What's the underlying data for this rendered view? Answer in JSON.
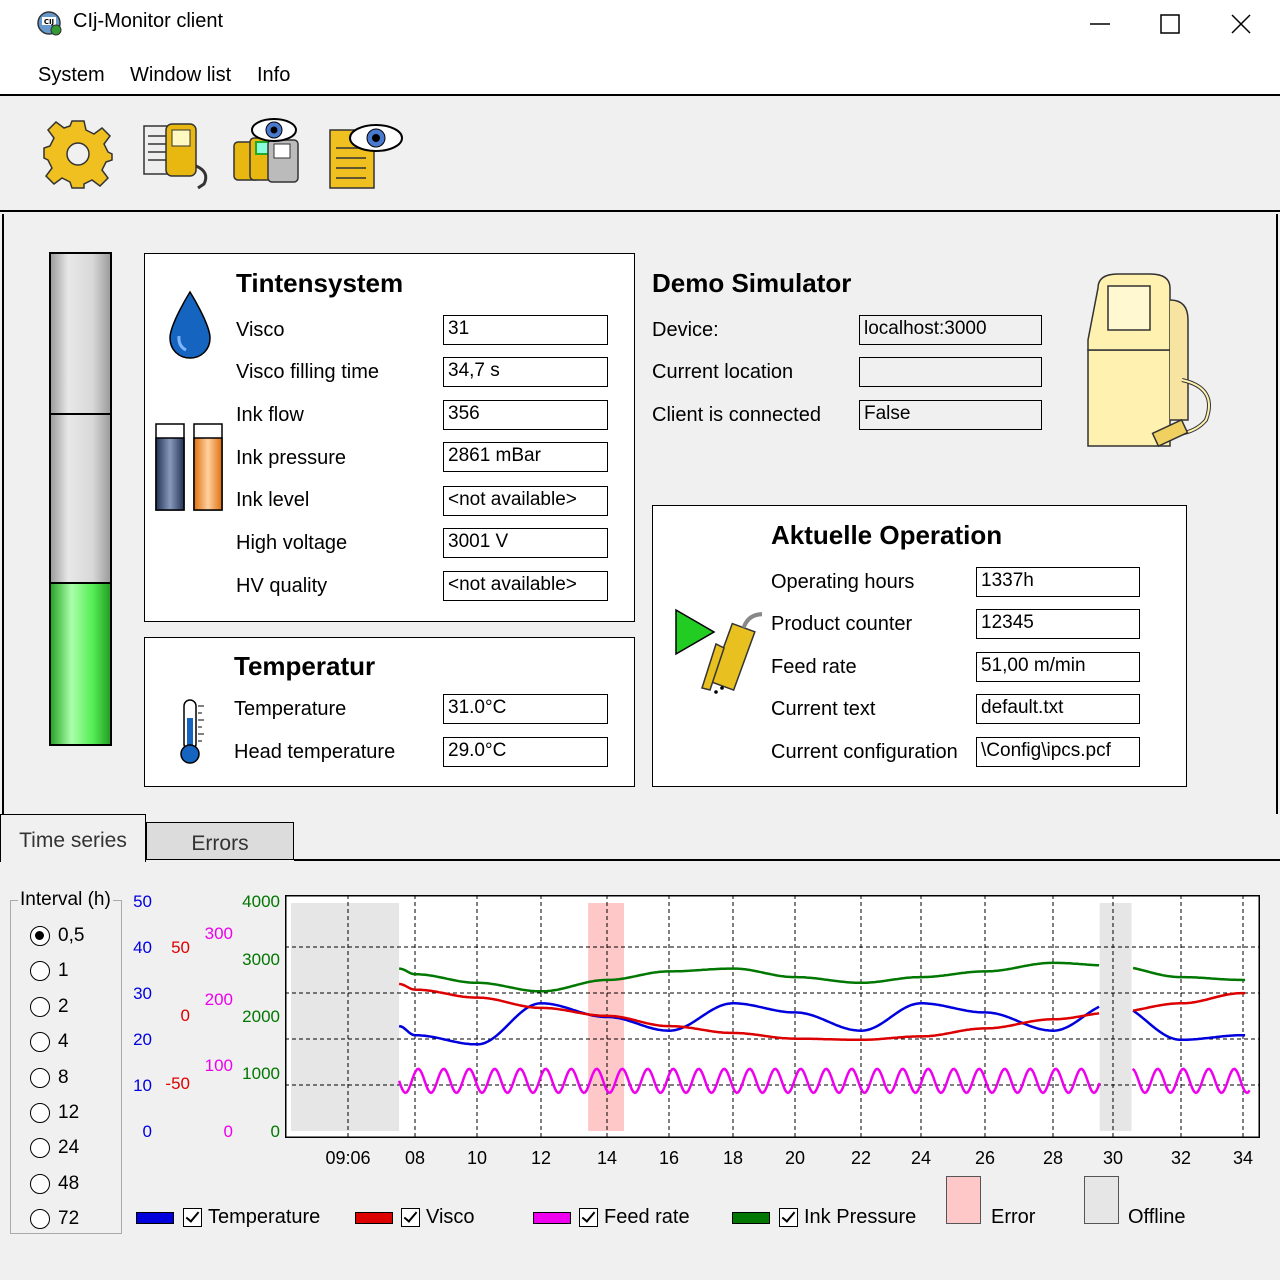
{
  "window": {
    "title": "CIj-Monitor client",
    "app_icon": "cij-logo-icon"
  },
  "menu": {
    "items": [
      "System",
      "Window list",
      "Info"
    ]
  },
  "toolbar": {
    "buttons": [
      "gear-icon",
      "printer-document-icon",
      "printers-watch-icon",
      "document-watch-icon"
    ]
  },
  "ink_system": {
    "title": "Tintensystem",
    "fields": [
      {
        "label": "Visco",
        "value": "31"
      },
      {
        "label": "Visco filling time",
        "value": "34,7 s"
      },
      {
        "label": "Ink flow",
        "value": "356"
      },
      {
        "label": "Ink pressure",
        "value": "2861 mBar"
      },
      {
        "label": "Ink level",
        "value": "<not available>"
      },
      {
        "label": "High voltage",
        "value": "3001 V"
      },
      {
        "label": "HV quality",
        "value": "<not available>"
      }
    ]
  },
  "temperature_panel": {
    "title": "Temperatur",
    "fields": [
      {
        "label": "Temperature",
        "value": "31.0°C"
      },
      {
        "label": "Head temperature",
        "value": "29.0°C"
      }
    ]
  },
  "device": {
    "title": "Demo Simulator",
    "fields": [
      {
        "label": "Device:",
        "value": "localhost:3000"
      },
      {
        "label": "Current location",
        "value": ""
      },
      {
        "label": "Client is connected",
        "value": "False"
      }
    ]
  },
  "operation": {
    "title": "Aktuelle Operation",
    "fields": [
      {
        "label": "Operating hours",
        "value": "1337h"
      },
      {
        "label": "Product counter",
        "value": "12345"
      },
      {
        "label": "Feed rate",
        "value": "51,00 m/min"
      },
      {
        "label": "Current text",
        "value": "default.txt"
      },
      {
        "label": "Current configuration",
        "value": "\\Config\\ipcs.pcf"
      }
    ]
  },
  "level_gauge": {
    "fill_fraction": 0.33,
    "color": "#33e033"
  },
  "tabs": [
    "Time series",
    "Errors"
  ],
  "interval": {
    "title": "Interval (h)",
    "options": [
      "0,5",
      "1",
      "2",
      "4",
      "8",
      "12",
      "24",
      "48",
      "72"
    ],
    "selected": "0,5"
  },
  "chart_data": {
    "type": "line",
    "x_ticks": [
      "09:06",
      "08",
      "10",
      "12",
      "14",
      "16",
      "18",
      "20",
      "22",
      "24",
      "26",
      "28",
      "30",
      "32",
      "34"
    ],
    "axes": [
      {
        "series": "Temperature",
        "color": "#0000dd",
        "ticks": [
          "50",
          "40",
          "30",
          "20",
          "10",
          "0"
        ],
        "range": [
          0,
          50
        ]
      },
      {
        "series": "Visco",
        "color": "#dd0000",
        "ticks": [
          "50",
          "0",
          "-50"
        ],
        "range": [
          -100,
          100
        ]
      },
      {
        "series": "Feed rate",
        "color": "#ee00ee",
        "ticks": [
          "300",
          "200",
          "100",
          "0"
        ],
        "range": [
          0,
          350
        ]
      },
      {
        "series": "Ink Pressure",
        "color": "#007700",
        "ticks": [
          "4000",
          "3000",
          "2000",
          "1000",
          "0"
        ],
        "range": [
          0,
          4000
        ]
      }
    ],
    "series": [
      {
        "name": "Temperature",
        "color": "#0000dd",
        "values": [
          23,
          21,
          19,
          28,
          25,
          22,
          28,
          26,
          22,
          28,
          26,
          22,
          28,
          20,
          21
        ]
      },
      {
        "name": "Visco",
        "color": "#dd0000",
        "values": [
          29,
          24,
          17,
          8,
          1,
          -8,
          -14,
          -19,
          -20,
          -17,
          -10,
          -2,
          4,
          12,
          21
        ]
      },
      {
        "name": "Feed rate",
        "color": "#ee00ee",
        "values": [
          77,
          77,
          77,
          77,
          77,
          77,
          77,
          77,
          77,
          77,
          77,
          77,
          77,
          77,
          77
        ]
      },
      {
        "name": "Ink Pressure",
        "color": "#007700",
        "values": [
          2850,
          2750,
          2600,
          2450,
          2650,
          2800,
          2850,
          2700,
          2600,
          2700,
          2800,
          2950,
          2900,
          2700,
          2650
        ]
      }
    ],
    "error_bands": [
      {
        "from": 13.5,
        "to": 14.5
      }
    ],
    "offline_bands": [
      {
        "from": 4.2,
        "to": 7.5
      },
      {
        "from": 29.5,
        "to": 30.5
      }
    ],
    "grid": true,
    "legend": [
      {
        "label": "Temperature",
        "color": "#0000dd",
        "checked": true
      },
      {
        "label": "Visco",
        "color": "#dd0000",
        "checked": true
      },
      {
        "label": "Feed rate",
        "color": "#ee00ee",
        "checked": true
      },
      {
        "label": "Ink Pressure",
        "color": "#007700",
        "checked": true
      },
      {
        "label": "Error",
        "color": "#ffc8c8"
      },
      {
        "label": "Offline",
        "color": "#e6e6e6"
      }
    ]
  }
}
